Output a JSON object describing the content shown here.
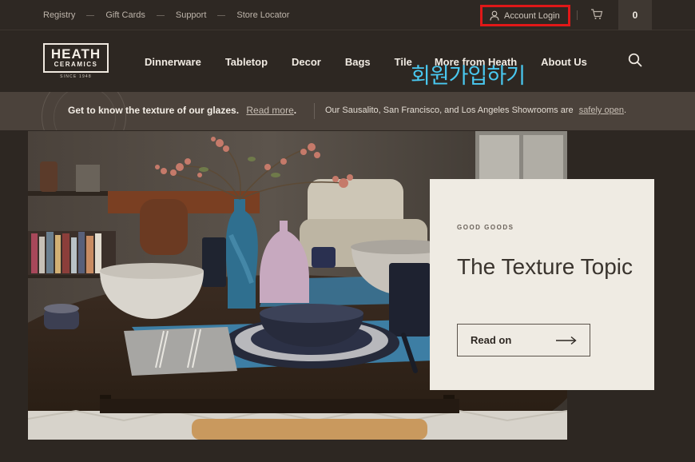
{
  "utility_bar": {
    "links": [
      "Registry",
      "Gift Cards",
      "Support",
      "Store Locator"
    ],
    "account_label": "Account Login",
    "cart_count": "0"
  },
  "annotation": {
    "korean_text": "회원가입하기",
    "highlight_color": "#e01818",
    "text_color": "#49c8f0"
  },
  "nav": {
    "logo_top": "HEATH",
    "logo_bottom": "CERAMICS",
    "logo_since": "SINCE 1948",
    "items": [
      "Dinnerware",
      "Tabletop",
      "Decor",
      "Bags",
      "Tile",
      "More from Heath",
      "About Us"
    ]
  },
  "announcement": {
    "left_text": "Get to know the texture of our glazes.",
    "left_link": "Read more",
    "left_period": ".",
    "right_text": "Our Sausalito, San Francisco, and Los Angeles Showrooms are",
    "right_link": "safely open",
    "right_period": "."
  },
  "hero_card": {
    "eyebrow": "GOOD GOODS",
    "title": "The Texture Topic",
    "button_label": "Read on"
  },
  "colors": {
    "background": "#2d2722",
    "announcement_bg": "#4b423b",
    "card_bg": "#efebe3"
  },
  "icons": [
    "user-icon",
    "cart-icon",
    "search-icon",
    "arrow-right-icon"
  ]
}
